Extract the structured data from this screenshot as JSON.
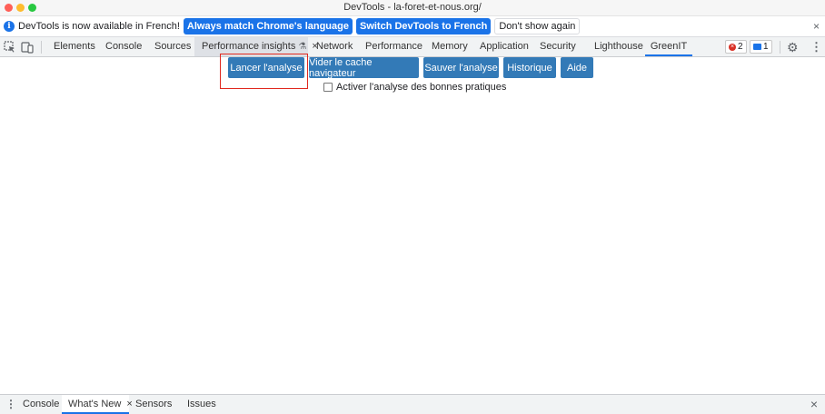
{
  "window": {
    "title": "DevTools - la-foret-et-nous.org/"
  },
  "infobar": {
    "icon": "info-icon",
    "icon_glyph": "i",
    "message": "DevTools is now available in French!",
    "btn_match": "Always match Chrome's language",
    "btn_switch": "Switch DevTools to French",
    "btn_dismiss": "Don't show again",
    "close": "×"
  },
  "tabbar": {
    "tabs": [
      {
        "label": "Elements"
      },
      {
        "label": "Console"
      },
      {
        "label": "Sources"
      },
      {
        "label": "Performance insights",
        "icon": "flask-icon",
        "icon_glyph": "⚗",
        "close": "×"
      },
      {
        "label": "Network"
      },
      {
        "label": "Performance"
      },
      {
        "label": "Memory"
      },
      {
        "label": "Application"
      },
      {
        "label": "Security"
      },
      {
        "label": "Lighthouse"
      },
      {
        "label": "GreenIT"
      }
    ],
    "active_tab": "GreenIT",
    "errors_count": "2",
    "messages_count": "1",
    "error_glyph": "×",
    "gear_glyph": "⚙",
    "kebab_glyph": "⋮"
  },
  "greenit": {
    "buttons": [
      {
        "label": "Lancer l'analyse"
      },
      {
        "label": "Vider le cache navigateur"
      },
      {
        "label": "Sauver l'analyse"
      },
      {
        "label": "Historique"
      },
      {
        "label": "Aide"
      }
    ],
    "checkbox_label": "Activer l'analyse des bonnes pratiques",
    "checkbox_checked": false
  },
  "drawer": {
    "kebab_glyph": "⋮",
    "tabs": [
      {
        "label": "Console"
      },
      {
        "label": "What's New",
        "close": "×"
      },
      {
        "label": "Sensors"
      },
      {
        "label": "Issues"
      }
    ],
    "active_tab": "What's New",
    "close": "×"
  },
  "colors": {
    "accent": "#1a73e8",
    "greenit_button": "#337ab7",
    "highlight": "#e0291f",
    "error": "#d93025"
  }
}
